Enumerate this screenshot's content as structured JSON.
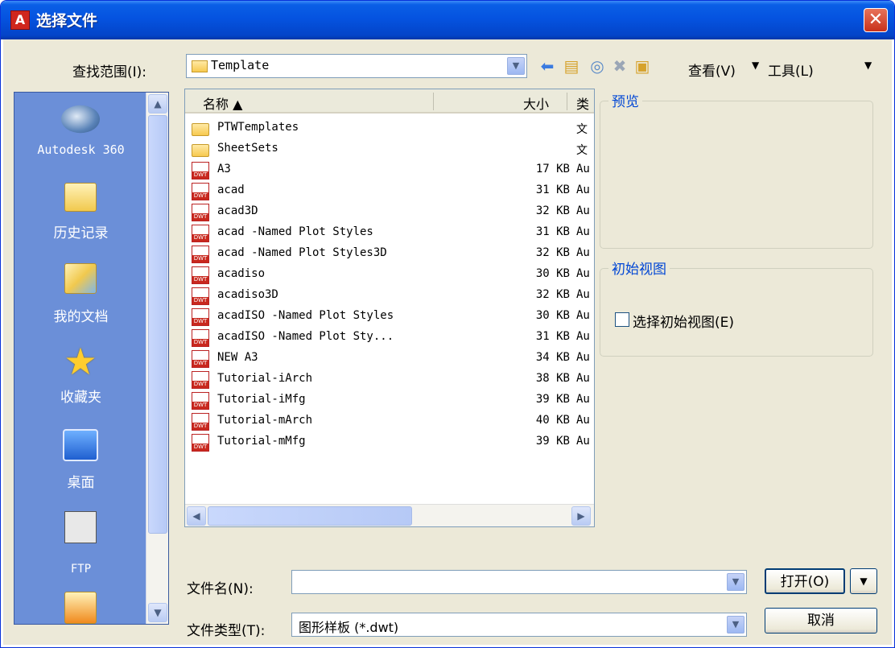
{
  "window": {
    "title": "选择文件",
    "close_glyph": "✕"
  },
  "lookin": {
    "label": "查找范围(I):",
    "value": "Template"
  },
  "toolbar": {
    "views_label": "查看(V)",
    "tools_label": "工具(L)"
  },
  "places": [
    {
      "label": "Autodesk 360",
      "icon": "autodesk360-icon"
    },
    {
      "label": "历史记录",
      "icon": "history-folder-icon"
    },
    {
      "label": "我的文档",
      "icon": "my-documents-icon"
    },
    {
      "label": "收藏夹",
      "icon": "favorites-star-icon"
    },
    {
      "label": "桌面",
      "icon": "desktop-icon"
    },
    {
      "label": "FTP",
      "icon": "ftp-icon"
    }
  ],
  "filelist": {
    "columns": {
      "name": "名称 ▲",
      "size": "大小",
      "type": "类"
    },
    "rows": [
      {
        "name": "PTWTemplates",
        "size": "",
        "type": "文",
        "kind": "folder"
      },
      {
        "name": "SheetSets",
        "size": "",
        "type": "文",
        "kind": "folder"
      },
      {
        "name": "A3",
        "size": "17 KB",
        "type": "Au",
        "kind": "dwt"
      },
      {
        "name": "acad",
        "size": "31 KB",
        "type": "Au",
        "kind": "dwt"
      },
      {
        "name": "acad3D",
        "size": "32 KB",
        "type": "Au",
        "kind": "dwt"
      },
      {
        "name": "acad -Named Plot Styles",
        "size": "31 KB",
        "type": "Au",
        "kind": "dwt"
      },
      {
        "name": "acad -Named Plot Styles3D",
        "size": "32 KB",
        "type": "Au",
        "kind": "dwt"
      },
      {
        "name": "acadiso",
        "size": "30 KB",
        "type": "Au",
        "kind": "dwt"
      },
      {
        "name": "acadiso3D",
        "size": "32 KB",
        "type": "Au",
        "kind": "dwt"
      },
      {
        "name": "acadISO -Named Plot Styles",
        "size": "30 KB",
        "type": "Au",
        "kind": "dwt"
      },
      {
        "name": "acadISO -Named Plot Sty...",
        "size": "31 KB",
        "type": "Au",
        "kind": "dwt"
      },
      {
        "name": "NEW A3",
        "size": "34 KB",
        "type": "Au",
        "kind": "dwt"
      },
      {
        "name": "Tutorial-iArch",
        "size": "38 KB",
        "type": "Au",
        "kind": "dwt"
      },
      {
        "name": "Tutorial-iMfg",
        "size": "39 KB",
        "type": "Au",
        "kind": "dwt"
      },
      {
        "name": "Tutorial-mArch",
        "size": "40 KB",
        "type": "Au",
        "kind": "dwt"
      },
      {
        "name": "Tutorial-mMfg",
        "size": "39 KB",
        "type": "Au",
        "kind": "dwt"
      }
    ]
  },
  "preview": {
    "title": "预览"
  },
  "initial_view": {
    "title": "初始视图",
    "checkbox_label": "选择初始视图(E)",
    "checked": false
  },
  "filename": {
    "label": "文件名(N):",
    "value": ""
  },
  "filetype": {
    "label": "文件类型(T):",
    "value": "图形样板 (*.dwt)"
  },
  "buttons": {
    "open": "打开(O)",
    "cancel": "取消"
  }
}
